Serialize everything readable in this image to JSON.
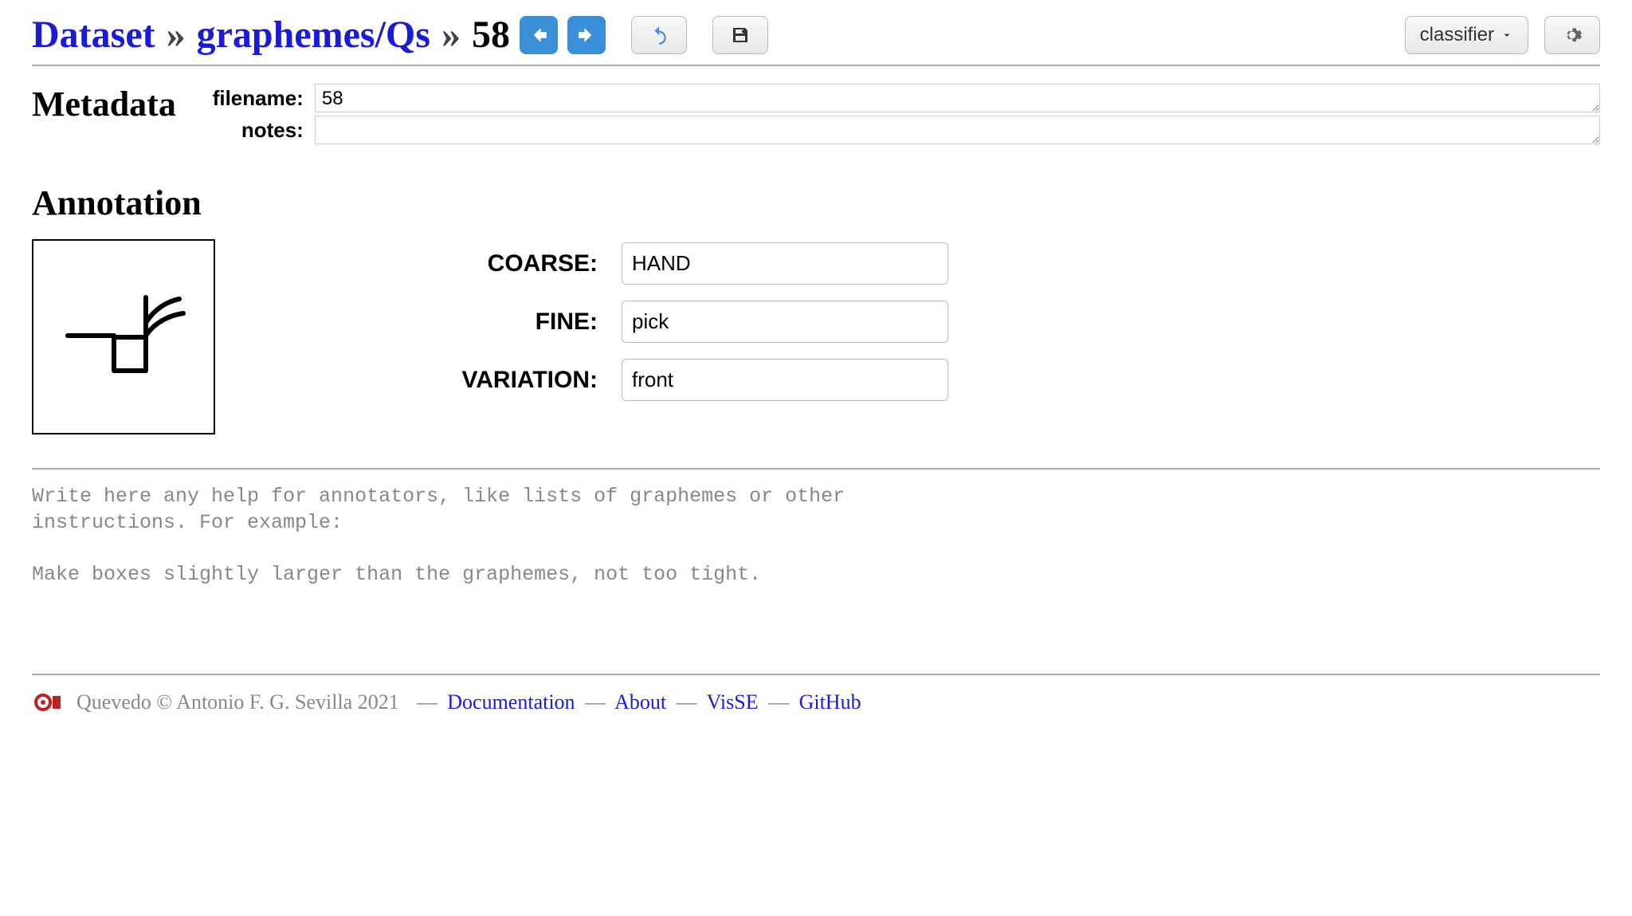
{
  "breadcrumb": {
    "root": "Dataset",
    "path": "graphemes/Qs",
    "current": "58"
  },
  "toolbar": {
    "classifier_label": "classifier"
  },
  "metadata": {
    "heading": "Metadata",
    "filename_label": "filename:",
    "filename_value": "58",
    "notes_label": "notes:",
    "notes_value": ""
  },
  "annotation": {
    "heading": "Annotation",
    "fields": [
      {
        "label": "COARSE:",
        "value": "HAND"
      },
      {
        "label": "FINE:",
        "value": "pick"
      },
      {
        "label": "VARIATION:",
        "value": "front"
      }
    ]
  },
  "help_text": "Write here any help for annotators, like lists of graphemes or other\ninstructions. For example:\n\nMake boxes slightly larger than the graphemes, not too tight.",
  "footer": {
    "copyright": "Quevedo © Antonio F. G. Sevilla 2021",
    "links": [
      {
        "label": "Documentation"
      },
      {
        "label": "About"
      },
      {
        "label": "VisSE"
      },
      {
        "label": "GitHub"
      }
    ]
  }
}
